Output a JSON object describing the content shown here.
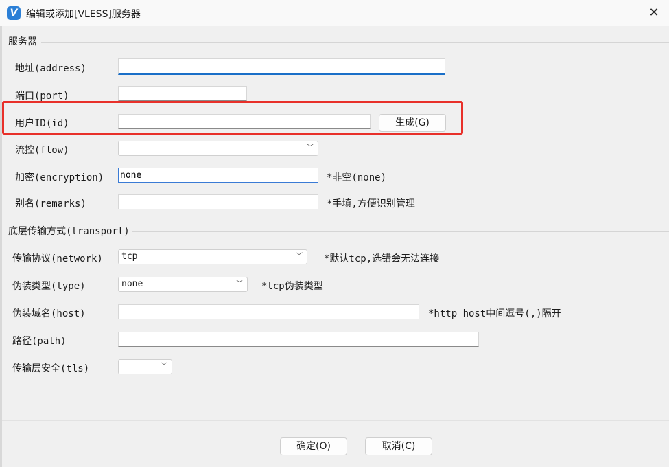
{
  "window": {
    "title": "编辑或添加[VLESS]服务器",
    "icon_letter": "V",
    "close_glyph": "✕"
  },
  "server_group": {
    "title": "服务器",
    "fields": {
      "address_label": "地址(address)",
      "address_value": "",
      "port_label": "端口(port)",
      "port_value": "",
      "id_label": "用户ID(id)",
      "id_value": "",
      "generate_button": "生成(G)",
      "flow_label": "流控(flow)",
      "flow_value": "",
      "encryption_label": "加密(encryption)",
      "encryption_value": "none",
      "encryption_hint": "*非空(none)",
      "remarks_label": "别名(remarks)",
      "remarks_value": "",
      "remarks_hint": "*手填,方便识别管理"
    }
  },
  "transport_group": {
    "title": "底层传输方式(transport)",
    "fields": {
      "network_label": "传输协议(network)",
      "network_value": "tcp",
      "network_hint": "*默认tcp,选错会无法连接",
      "type_label": "伪装类型(type)",
      "type_value": "none",
      "type_hint": "*tcp伪装类型",
      "host_label": "伪装域名(host)",
      "host_value": "",
      "host_hint": "*http host中间逗号(,)隔开",
      "path_label": "路径(path)",
      "path_value": "",
      "tls_label": "传输层安全(tls)",
      "tls_value": ""
    }
  },
  "footer": {
    "ok_button": "确定(O)",
    "cancel_button": "取消(C)"
  },
  "colors": {
    "highlight_box": "#e8302a",
    "focus_underline": "#1a6fc8",
    "app_icon": "#2b7fd6"
  }
}
